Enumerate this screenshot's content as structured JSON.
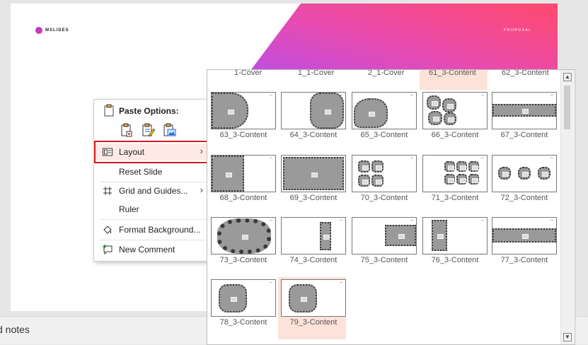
{
  "slide": {
    "logo_text": "MSLIDES",
    "header_label": "PROPOSAL",
    "gradient_colors": [
      "#b14ff0",
      "#e84bb0",
      "#ff4a6e"
    ]
  },
  "notes": {
    "label": "d notes"
  },
  "context_menu": {
    "paste_title": "Paste Options:",
    "paste_icons": [
      "paste-use-destination-theme-icon",
      "paste-keep-source-formatting-icon",
      "paste-picture-icon"
    ],
    "items": [
      {
        "label": "Layout",
        "icon": "layout-icon",
        "submenu": true,
        "highlighted": true
      },
      {
        "label": "Reset Slide",
        "icon": "",
        "submenu": false
      },
      {
        "label": "Grid and Guides...",
        "icon": "grid-icon",
        "submenu": true
      },
      {
        "label": "Ruler",
        "icon": "",
        "submenu": false
      },
      {
        "label": "Format Background...",
        "icon": "format-background-icon",
        "submenu": false
      },
      {
        "label": "New Comment",
        "icon": "new-comment-icon",
        "submenu": false
      }
    ]
  },
  "gallery": {
    "top_row_labels": [
      "1-Cover",
      "1_1-Cover",
      "2_1-Cover",
      "61_3-Content",
      "62_3-Content"
    ],
    "layouts": [
      [
        "63_3-Content",
        "64_3-Content",
        "65_3-Content",
        "66_3-Content",
        "67_3-Content"
      ],
      [
        "68_3-Content",
        "69_3-Content",
        "70_3-Content",
        "71_3-Content",
        "72_3-Content"
      ],
      [
        "73_3-Content",
        "74_3-Content",
        "75_3-Content",
        "76_3-Content",
        "77_3-Content"
      ],
      [
        "78_3-Content",
        "79_3-Content"
      ]
    ],
    "selected_layout": "79_3-Content",
    "selected_color": "#fde2d9"
  }
}
